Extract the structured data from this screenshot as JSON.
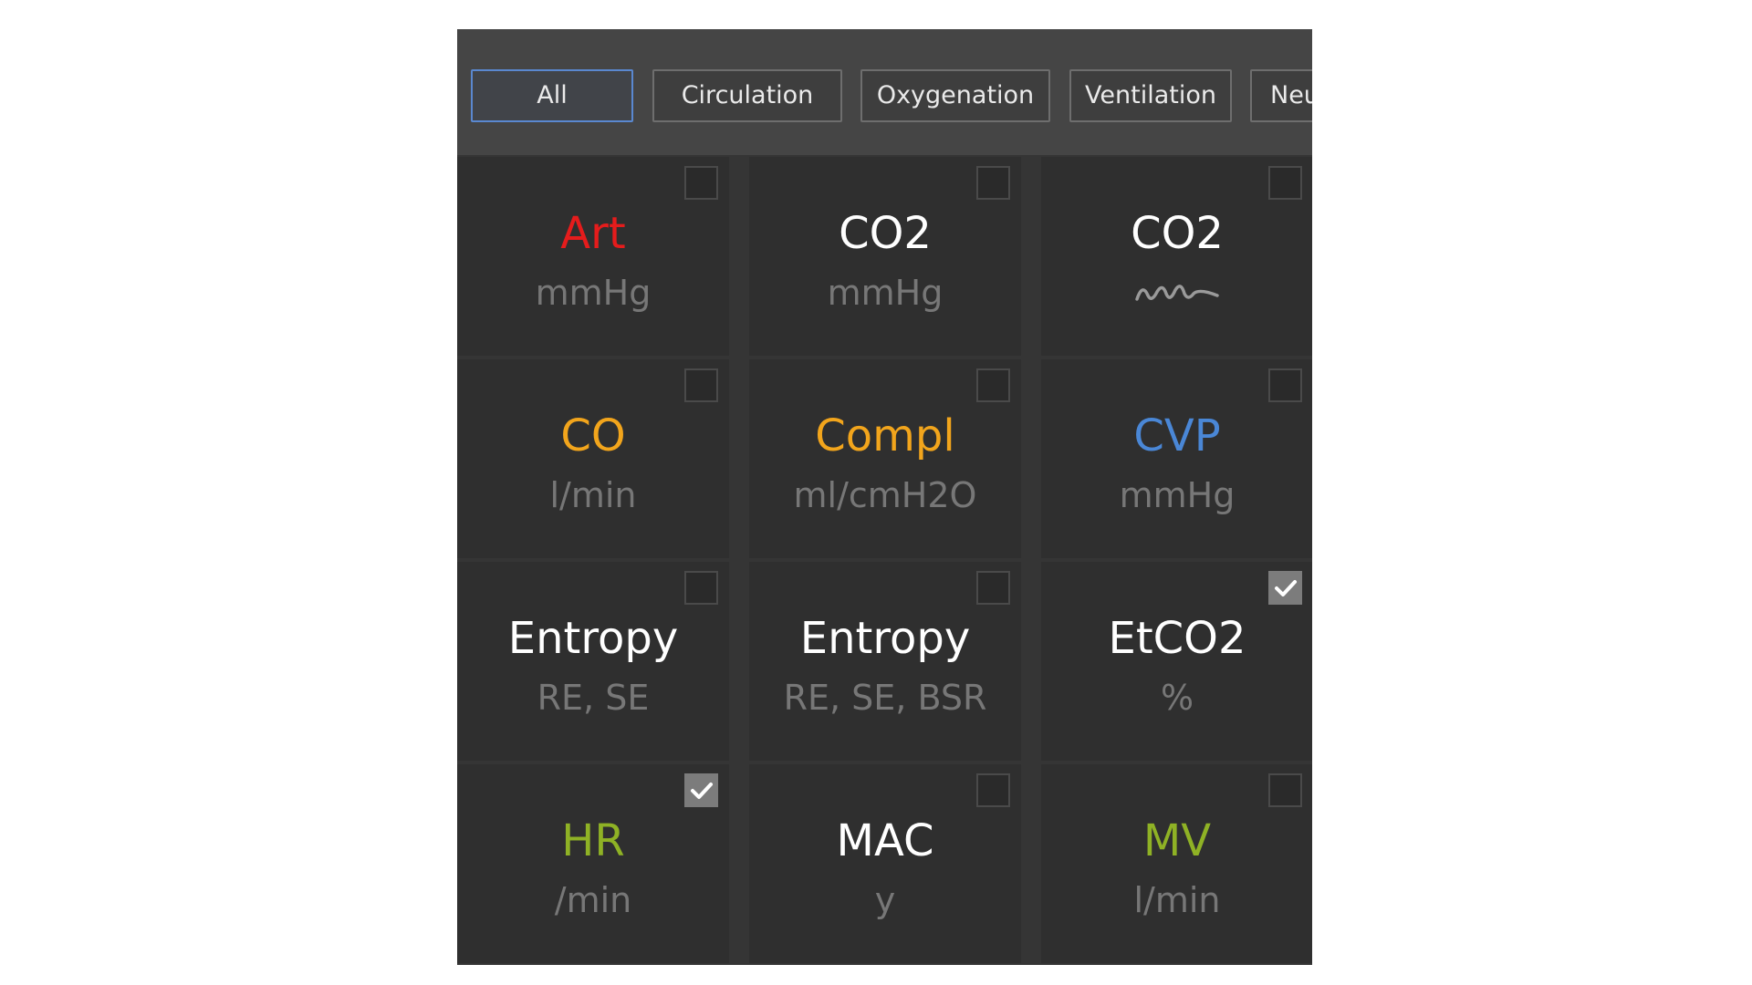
{
  "tabs": [
    {
      "label": "All",
      "active": true
    },
    {
      "label": "Circulation",
      "active": false
    },
    {
      "label": "Oxygenation",
      "active": false
    },
    {
      "label": "Ventilation",
      "active": false
    },
    {
      "label": "Neu",
      "active": false
    }
  ],
  "tiles": [
    {
      "label": "Art",
      "unit": "mmHg",
      "color": "#e51c1c",
      "checked": false
    },
    {
      "label": "CO2",
      "unit": "mmHg",
      "color": "#ffffff",
      "checked": false
    },
    {
      "label": "CO2",
      "unit": "",
      "icon": "co2-waveform-icon",
      "color": "#ffffff",
      "checked": false
    },
    {
      "label": "CO",
      "unit": "l/min",
      "color": "#f2a51c",
      "checked": false
    },
    {
      "label": "Compl",
      "unit": "ml/cmH2O",
      "color": "#f2a51c",
      "checked": false
    },
    {
      "label": "CVP",
      "unit": "mmHg",
      "color": "#4a87d6",
      "checked": false
    },
    {
      "label": "Entropy",
      "unit": "RE, SE",
      "color": "#ffffff",
      "checked": false
    },
    {
      "label": "Entropy",
      "unit": "RE, SE, BSR",
      "color": "#ffffff",
      "checked": false
    },
    {
      "label": "EtCO2",
      "unit": "%",
      "color": "#ffffff",
      "checked": true
    },
    {
      "label": "HR",
      "unit": "/min",
      "color": "#8fb225",
      "checked": true
    },
    {
      "label": "MAC",
      "unit": "y",
      "color": "#ffffff",
      "checked": false
    },
    {
      "label": "MV",
      "unit": "l/min",
      "color": "#8fb225",
      "checked": false
    }
  ],
  "colors": {
    "panel_bg": "#353535",
    "tab_active_border": "#5a88d0",
    "unit_text": "#777777"
  }
}
